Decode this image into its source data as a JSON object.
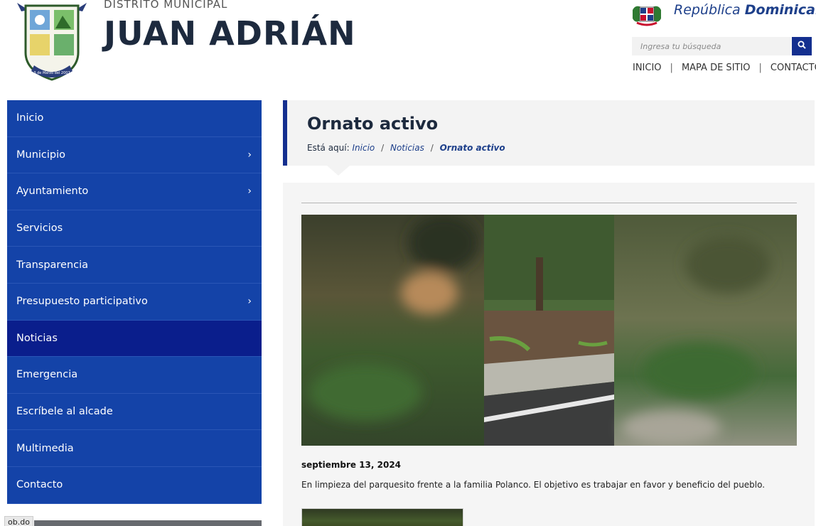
{
  "header": {
    "district_label": "DISTRITO MUNICIPAL",
    "municipality_name": "JUAN ADRIÁN",
    "crest_motto": "3 de Marzo del 2007",
    "republic_prefix": "República",
    "republic_name": "Dominicana",
    "search": {
      "placeholder": "Ingresa tu búsqueda",
      "icon": "search-icon"
    },
    "top_links": [
      "INICIO",
      "MAPA DE SITIO",
      "CONTACTO"
    ]
  },
  "sidebar": {
    "items": [
      {
        "label": "Inicio",
        "has_submenu": false,
        "active": false
      },
      {
        "label": "Municipio",
        "has_submenu": true,
        "active": false
      },
      {
        "label": "Ayuntamiento",
        "has_submenu": true,
        "active": false
      },
      {
        "label": "Servicios",
        "has_submenu": false,
        "active": false
      },
      {
        "label": "Transparencia",
        "has_submenu": false,
        "active": false
      },
      {
        "label": "Presupuesto participativo",
        "has_submenu": true,
        "active": false
      },
      {
        "label": "Noticias",
        "has_submenu": false,
        "active": true
      },
      {
        "label": "Emergencia",
        "has_submenu": false,
        "active": false
      },
      {
        "label": "Escríbele al alcade",
        "has_submenu": false,
        "active": false
      },
      {
        "label": "Multimedia",
        "has_submenu": false,
        "active": false
      },
      {
        "label": "Contacto",
        "has_submenu": false,
        "active": false
      }
    ],
    "chevron": "›",
    "colors": {
      "background": "#1443a8",
      "active": "#0a1e8c"
    }
  },
  "status_bar": {
    "url_fragment": "ob.do"
  },
  "main": {
    "title": "Ornato activo",
    "breadcrumb": {
      "prefix": "Está aquí:",
      "items": [
        "Inicio",
        "Noticias"
      ],
      "current": "Ornato activo"
    },
    "post": {
      "date": "septiembre 13, 2024",
      "text": "En limpieza del parquesito frente a la familia Polanco. El objetivo es trabajar en favor y beneficio del pueblo."
    }
  },
  "colors": {
    "brand_dark_blue": "#142f8f",
    "title_text": "#1d2a3e",
    "link_blue": "#1d3f8a"
  }
}
